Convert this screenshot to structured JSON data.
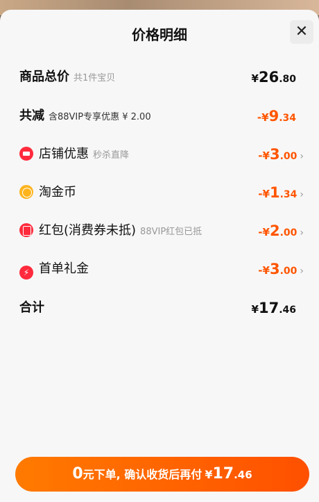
{
  "sheet": {
    "title": "价格明细",
    "close_glyph": "✕"
  },
  "rows": {
    "total_goods": {
      "label": "商品总价",
      "sub": "共1件宝贝",
      "currency": "¥",
      "int": "26",
      "dec": ".80"
    },
    "reduction": {
      "label": "共减",
      "sub": "含88VIP专享优惠 ¥ 2.00",
      "sign": "-¥",
      "int": "9",
      "dec": ".34"
    },
    "shop_discount": {
      "icon": "shop-icon",
      "label": "店铺优惠",
      "sub": "秒杀直降",
      "sign": "-¥",
      "int": "3",
      "dec": ".00"
    },
    "gold_coin": {
      "icon": "coin-icon",
      "label": "淘金币",
      "sub": "",
      "sign": "-¥",
      "int": "1",
      "dec": ".34"
    },
    "red_packet": {
      "icon": "red-packet-icon",
      "label": "红包(消费券未抵)",
      "sub": "88VIP红包已抵",
      "sign": "-¥",
      "int": "2",
      "dec": ".00"
    },
    "first_order": {
      "icon": "lightning-icon",
      "label": "首单礼金",
      "sub": "",
      "sign": "-¥",
      "int": "3",
      "dec": ".00"
    },
    "grand_total": {
      "label": "合计",
      "currency": "¥",
      "int": "17",
      "dec": ".46"
    }
  },
  "chevron": "›",
  "pay_button": {
    "zero": "0",
    "text": "元下单, 确认收货后再付",
    "currency": "¥",
    "int": "17",
    "dec": ".46"
  },
  "colors": {
    "accent": "#ff5500",
    "badge_red": "#ff2a3c",
    "coin_gold": "#ffb41e"
  }
}
